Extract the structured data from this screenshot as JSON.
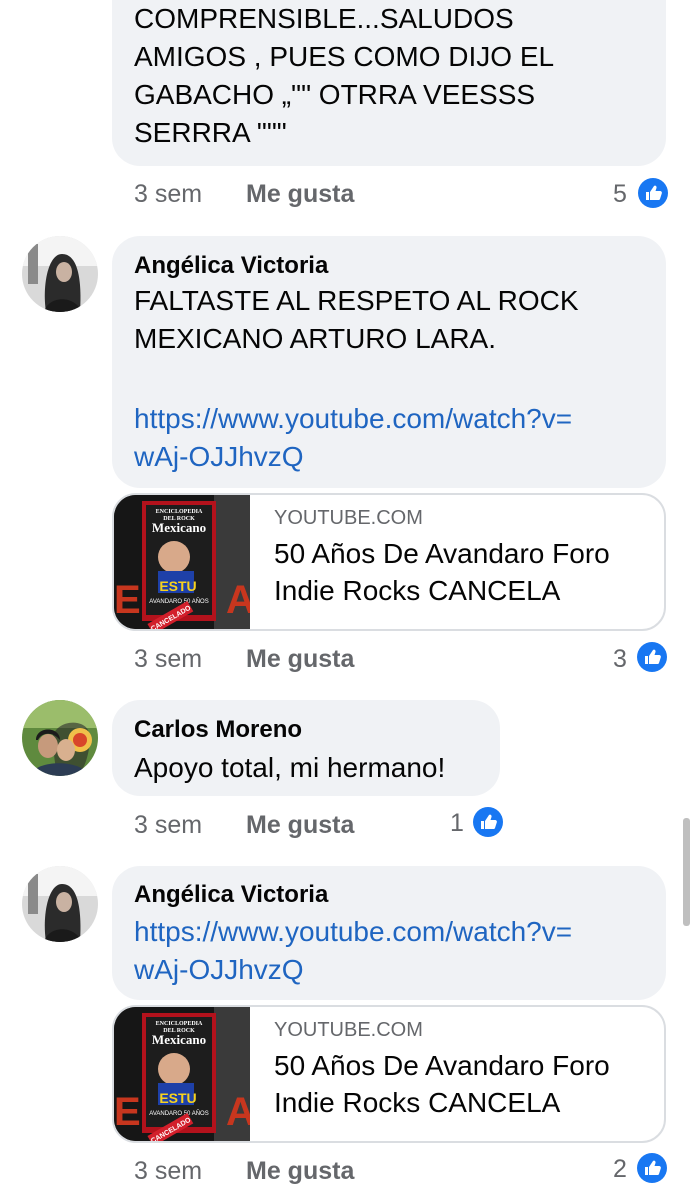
{
  "comments": [
    {
      "text_lines": [
        "COMPRENSIBLE...SALUDOS",
        "AMIGOS , PUES COMO DIJO EL",
        "GABACHO „\"\" OTRRA VEESSS",
        "SERRRA \"\"\""
      ],
      "time": "3 sem",
      "like_label": "Me gusta",
      "reactions": "5"
    },
    {
      "author": "Angélica Victoria",
      "text_lines": [
        "FALTASTE AL RESPETO AL ROCK",
        "MEXICANO ARTURO LARA."
      ],
      "link_lines": [
        "https://www.youtube.com/watch?v=",
        "wAj-OJJhvzQ"
      ],
      "preview": {
        "domain": "YOUTUBE.COM",
        "title_lines": [
          "50 Años De Avandaro Foro",
          "Indie Rocks CANCELA"
        ],
        "thumb_text": [
          "ENCICLOPEDIA",
          "DEL ROCK",
          "Mexicano",
          "AVANDARO 50 AÑOS",
          "CANCELADO"
        ]
      },
      "time": "3 sem",
      "like_label": "Me gusta",
      "reactions": "3"
    },
    {
      "author": "Carlos Moreno",
      "text_lines": [
        "Apoyo total, mi hermano!"
      ],
      "time": "3 sem",
      "like_label": "Me gusta",
      "reactions": "1"
    },
    {
      "author": "Angélica Victoria",
      "link_lines": [
        "https://www.youtube.com/watch?v=",
        "wAj-OJJhvzQ"
      ],
      "preview": {
        "domain": "YOUTUBE.COM",
        "title_lines": [
          "50 Años De Avandaro Foro",
          "Indie Rocks CANCELA"
        ],
        "thumb_text": [
          "ENCICLOPEDIA",
          "DEL ROCK",
          "Mexicano",
          "AVANDARO 50 AÑOS",
          "CANCELADO"
        ]
      },
      "time": "3 sem",
      "like_label": "Me gusta",
      "reactions": "2"
    }
  ],
  "colors": {
    "bubble": "#f0f2f5",
    "link": "#1f65c1",
    "meta": "#65676b",
    "like_blue": "#1877f2"
  },
  "icons": {
    "reaction": "like-thumb-icon"
  }
}
